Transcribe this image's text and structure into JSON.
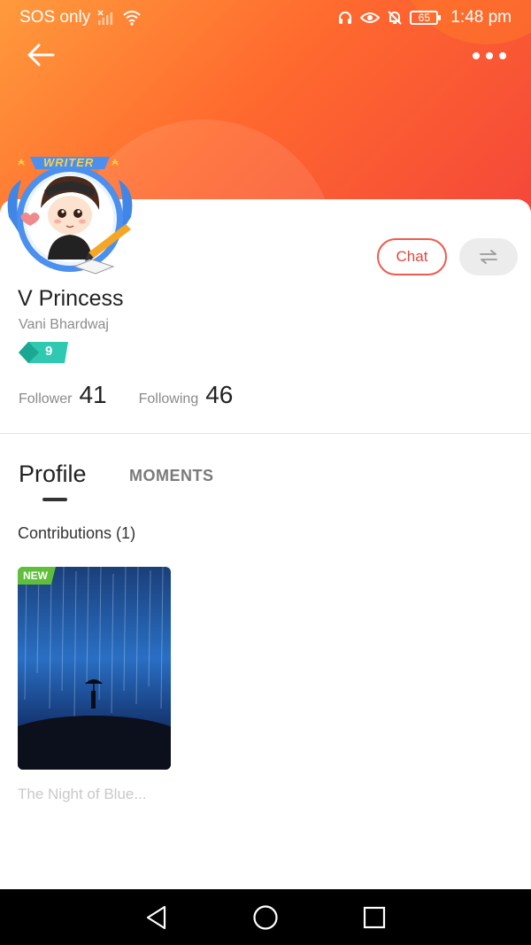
{
  "status_bar": {
    "carrier": "SOS only",
    "battery": "65",
    "time": "1:48 pm"
  },
  "profile": {
    "avatar_badge": "WRITER",
    "display_name": "V Princess",
    "username": "Vani Bhardwaj",
    "level": "9",
    "follower_label": "Follower",
    "follower_count": "41",
    "following_label": "Following",
    "following_count": "46"
  },
  "actions": {
    "chat_label": "Chat"
  },
  "tabs": {
    "profile_label": "Profile",
    "moments_label": "MOMENTS"
  },
  "contributions": {
    "heading": "Contributions (1)",
    "items": [
      {
        "badge": "NEW",
        "title": "The Night of Blue..."
      }
    ]
  },
  "colors": {
    "header_start": "#ff9a3c",
    "header_end": "#f4463a",
    "chat_accent": "#e0483e",
    "new_badge": "#5fbf3a",
    "level_badge": "#2ec9b0"
  }
}
